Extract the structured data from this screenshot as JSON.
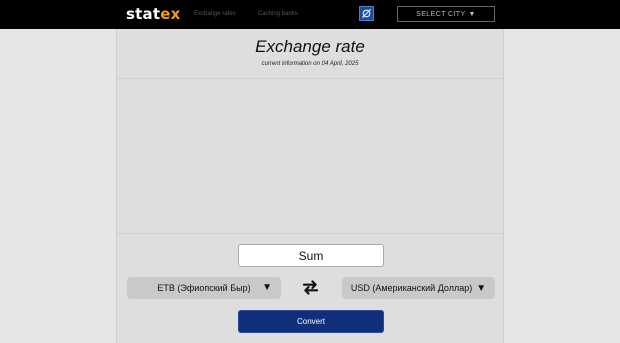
{
  "header": {
    "logo_part1": "stat",
    "logo_part2": "ex",
    "nav": [
      {
        "label": "Exchange rates"
      },
      {
        "label": "Cashing banks"
      }
    ],
    "city_button": "SELECT CITY",
    "city_caret": "▼",
    "brand_color": "#f39c12"
  },
  "main": {
    "title": "Exchange rate",
    "subtitle": "current information on 04 April, 2025",
    "sum_placeholder": "Sum",
    "from_currency": "ETB (Эфиопский Быр)",
    "to_currency": "USD (Американский Доллар)",
    "caret": "▼",
    "convert_label": "Convert",
    "convert_color": "#0f2f7a"
  },
  "icons": {
    "swap_header": "swap-circle-icon",
    "swap_currencies": "swap-arrows-icon"
  }
}
